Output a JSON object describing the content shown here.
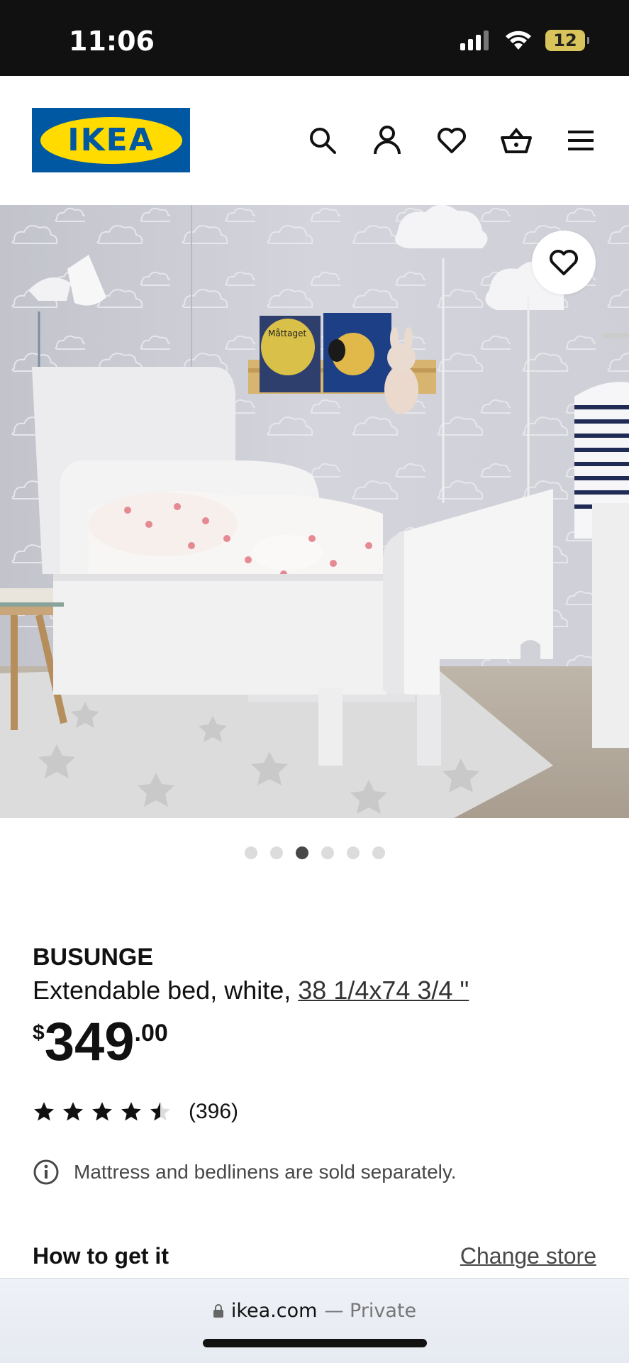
{
  "status_bar": {
    "time": "11:06",
    "battery": "12"
  },
  "header": {
    "logo_text": "IKEA",
    "icons": [
      "search-icon",
      "account-icon",
      "favourites-icon",
      "basket-icon",
      "menu-icon"
    ]
  },
  "hero": {
    "book_title": "Måttaget",
    "page_count": 6,
    "active_page": 3
  },
  "product": {
    "name": "BUSUNGE",
    "description": "Extendable bed, white, ",
    "dimensions": "38 1/4x74 3/4 \"",
    "price_currency": "$",
    "price_integer": "349",
    "price_decimal": ".00",
    "rating": 4.5,
    "review_count": "(396)",
    "notice": "Mattress and bedlinens are sold separately."
  },
  "delivery": {
    "title": "How to get it",
    "change_store": "Change store"
  },
  "browser": {
    "domain": "ikea.com",
    "mode": " — Private"
  },
  "colors": {
    "ikea_blue": "#0058a3",
    "ikea_yellow": "#ffdb00"
  }
}
